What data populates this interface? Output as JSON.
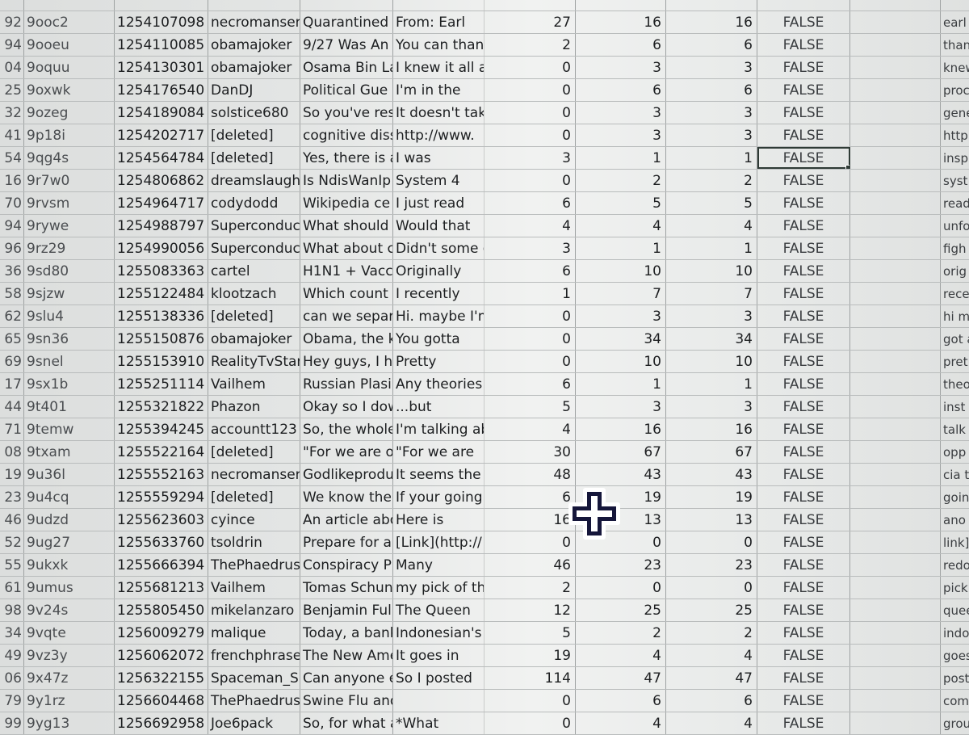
{
  "spreadsheet": {
    "rows": [
      {
        "n": "92",
        "id": "9ooc2",
        "ts": "1254107098",
        "author": "necromanser",
        "title": "Quarantined",
        "body": "From: Earl",
        "a": "27",
        "b": "16",
        "c": "16",
        "flag": "FALSE",
        "extra": "",
        "text": "earl"
      },
      {
        "n": "94",
        "id": "9ooeu",
        "ts": "1254110085",
        "author": "obamajoker",
        "title": "9/27 Was An",
        "body": "You can than",
        "a": "2",
        "b": "6",
        "c": "6",
        "flag": "FALSE",
        "extra": "",
        "text": "than"
      },
      {
        "n": "04",
        "id": "9oquu",
        "ts": "1254130301",
        "author": "obamajoker",
        "title": "Osama Bin La",
        "body": "I knew it all a",
        "a": "0",
        "b": "3",
        "c": "3",
        "flag": "FALSE",
        "extra": "",
        "text": "knew"
      },
      {
        "n": "25",
        "id": "9oxwk",
        "ts": "1254176540",
        "author": "DanDJ",
        "title": "Political Gue",
        "body": "I'm in the",
        "a": "0",
        "b": "6",
        "c": "6",
        "flag": "FALSE",
        "extra": "",
        "text": "proc"
      },
      {
        "n": "32",
        "id": "9ozeg",
        "ts": "1254189084",
        "author": "solstice680",
        "title": "So you've res",
        "body": "It doesn't tak",
        "a": "0",
        "b": "3",
        "c": "3",
        "flag": "FALSE",
        "extra": "",
        "text": "gene"
      },
      {
        "n": "41",
        "id": "9p18i",
        "ts": "1254202717",
        "author": "[deleted]",
        "title": "cognitive diss",
        "body": "http://www.",
        "a": "0",
        "b": "3",
        "c": "3",
        "flag": "FALSE",
        "extra": "",
        "text": "http"
      },
      {
        "n": "54",
        "id": "9qg4s",
        "ts": "1254564784",
        "author": "[deleted]",
        "title": "Yes, there is a",
        "body": "I was",
        "a": "3",
        "b": "1",
        "c": "1",
        "flag": "FALSE",
        "extra": "",
        "text": "insp",
        "selected": true
      },
      {
        "n": "16",
        "id": "9r7w0",
        "ts": "1254806862",
        "author": "dreamslaugh",
        "title": "Is NdisWanIp",
        "body": "System 4",
        "a": "0",
        "b": "2",
        "c": "2",
        "flag": "FALSE",
        "extra": "",
        "text": "syst"
      },
      {
        "n": "70",
        "id": "9rvsm",
        "ts": "1254964717",
        "author": "codydodd",
        "title": "Wikipedia ce",
        "body": "I just read",
        "a": "6",
        "b": "5",
        "c": "5",
        "flag": "FALSE",
        "extra": "",
        "text": "read"
      },
      {
        "n": "94",
        "id": "9rywe",
        "ts": "1254988797",
        "author": "Superconduc",
        "title": "What should",
        "body": "Would that",
        "a": "4",
        "b": "4",
        "c": "4",
        "flag": "FALSE",
        "extra": "",
        "text": "unfo"
      },
      {
        "n": "96",
        "id": "9rz29",
        "ts": "1254990056",
        "author": "Superconduc",
        "title": "What about c",
        "body": "Didn't some c",
        "a": "3",
        "b": "1",
        "c": "1",
        "flag": "FALSE",
        "extra": "",
        "text": "figh"
      },
      {
        "n": "36",
        "id": "9sd80",
        "ts": "1255083363",
        "author": "cartel",
        "title": "H1N1 + Vacc",
        "body": "Originally",
        "a": "6",
        "b": "10",
        "c": "10",
        "flag": "FALSE",
        "extra": "",
        "text": "orig"
      },
      {
        "n": "58",
        "id": "9sjzw",
        "ts": "1255122484",
        "author": "klootzach",
        "title": "Which count",
        "body": "I recently",
        "a": "1",
        "b": "7",
        "c": "7",
        "flag": "FALSE",
        "extra": "",
        "text": "rece"
      },
      {
        "n": "62",
        "id": "9slu4",
        "ts": "1255138336",
        "author": "[deleted]",
        "title": "can we separ",
        "body": "Hi. maybe I'm",
        "a": "0",
        "b": "3",
        "c": "3",
        "flag": "FALSE",
        "extra": "",
        "text": "hi m"
      },
      {
        "n": "65",
        "id": "9sn36",
        "ts": "1255150876",
        "author": "obamajoker",
        "title": "Obama, the k",
        "body": "You gotta",
        "a": "0",
        "b": "34",
        "c": "34",
        "flag": "FALSE",
        "extra": "",
        "text": "got a"
      },
      {
        "n": "69",
        "id": "9snel",
        "ts": "1255153910",
        "author": "RealityTvStar",
        "title": "Hey guys, I ha",
        "body": "Pretty",
        "a": "0",
        "b": "10",
        "c": "10",
        "flag": "FALSE",
        "extra": "",
        "text": "pret"
      },
      {
        "n": "17",
        "id": "9sx1b",
        "ts": "1255251114",
        "author": "Vailhem",
        "title": "Russian Plasi",
        "body": "Any theories",
        "a": "6",
        "b": "1",
        "c": "1",
        "flag": "FALSE",
        "extra": "",
        "text": "theo"
      },
      {
        "n": "44",
        "id": "9t401",
        "ts": "1255321822",
        "author": "Phazon",
        "title": "Okay so I dow",
        "body": "...but",
        "a": "5",
        "b": "3",
        "c": "3",
        "flag": "FALSE",
        "extra": "",
        "text": "inst"
      },
      {
        "n": "71",
        "id": "9temw",
        "ts": "1255394245",
        "author": "accountt123",
        "title": "So, the whole",
        "body": "I'm talking ab",
        "a": "4",
        "b": "16",
        "c": "16",
        "flag": "FALSE",
        "extra": "",
        "text": "talk"
      },
      {
        "n": "08",
        "id": "9txam",
        "ts": "1255522164",
        "author": "[deleted]",
        "title": "\"For we are o",
        "body": "\"For we are",
        "a": "30",
        "b": "67",
        "c": "67",
        "flag": "FALSE",
        "extra": "",
        "text": "opp"
      },
      {
        "n": "19",
        "id": "9u36l",
        "ts": "1255552163",
        "author": "necromanser",
        "title": "Godlikeprodu",
        "body": "It seems the",
        "a": "48",
        "b": "43",
        "c": "43",
        "flag": "FALSE",
        "extra": "",
        "text": "cia t"
      },
      {
        "n": "23",
        "id": "9u4cq",
        "ts": "1255559294",
        "author": "[deleted]",
        "title": "We know the",
        "body": "If your going",
        "a": "6",
        "b": "19",
        "c": "19",
        "flag": "FALSE",
        "extra": "",
        "text": "goin"
      },
      {
        "n": "46",
        "id": "9udzd",
        "ts": "1255623603",
        "author": "cyince",
        "title": "An article abo",
        "body": "Here is",
        "a": "16",
        "b": "13",
        "c": "13",
        "flag": "FALSE",
        "extra": "",
        "text": "ano"
      },
      {
        "n": "52",
        "id": "9ug27",
        "ts": "1255633760",
        "author": "tsoldrin",
        "title": "Prepare for a",
        "body": "[Link](http://",
        "a": "0",
        "b": "0",
        "c": "0",
        "flag": "FALSE",
        "extra": "",
        "text": "link]"
      },
      {
        "n": "55",
        "id": "9ukxk",
        "ts": "1255666394",
        "author": "ThePhaedrus",
        "title": "Conspiracy P",
        "body": "Many",
        "a": "46",
        "b": "23",
        "c": "23",
        "flag": "FALSE",
        "extra": "",
        "text": "redo"
      },
      {
        "n": "61",
        "id": "9umus",
        "ts": "1255681213",
        "author": "Vailhem",
        "title": "Tomas Schun",
        "body": "my pick of the",
        "a": "2",
        "b": "0",
        "c": "0",
        "flag": "FALSE",
        "extra": "",
        "text": "pick"
      },
      {
        "n": "98",
        "id": "9v24s",
        "ts": "1255805450",
        "author": "mikelanzaro",
        "title": "Benjamin Ful",
        "body": "The Queen",
        "a": "12",
        "b": "25",
        "c": "25",
        "flag": "FALSE",
        "extra": "",
        "text": "quee"
      },
      {
        "n": "34",
        "id": "9vqte",
        "ts": "1256009279",
        "author": "malique",
        "title": "Today, a bank",
        "body": "Indonesian's",
        "a": "5",
        "b": "2",
        "c": "2",
        "flag": "FALSE",
        "extra": "",
        "text": "indo"
      },
      {
        "n": "49",
        "id": "9vz3y",
        "ts": "1256062072",
        "author": "frenchphrase",
        "title": "The New Ame",
        "body": "It goes in",
        "a": "19",
        "b": "4",
        "c": "4",
        "flag": "FALSE",
        "extra": "",
        "text": "goes"
      },
      {
        "n": "06",
        "id": "9x47z",
        "ts": "1256322155",
        "author": "Spaceman_S",
        "title": "Can anyone e",
        "body": "So I posted",
        "a": "114",
        "b": "47",
        "c": "47",
        "flag": "FALSE",
        "extra": "",
        "text": "post"
      },
      {
        "n": "79",
        "id": "9y1rz",
        "ts": "1256604468",
        "author": "ThePhaedrus",
        "title": "Swine Flu and",
        "body": "",
        "a": "0",
        "b": "6",
        "c": "6",
        "flag": "FALSE",
        "extra": "",
        "text": "com"
      },
      {
        "n": "99",
        "id": "9yg13",
        "ts": "1256692958",
        "author": "Joe6pack",
        "title": "So, for what a",
        "body": "*What",
        "a": "0",
        "b": "4",
        "c": "4",
        "flag": "FALSE",
        "extra": "",
        "text": "grou"
      }
    ]
  },
  "cursor": {
    "icon": "crosshair-plus-cursor"
  }
}
